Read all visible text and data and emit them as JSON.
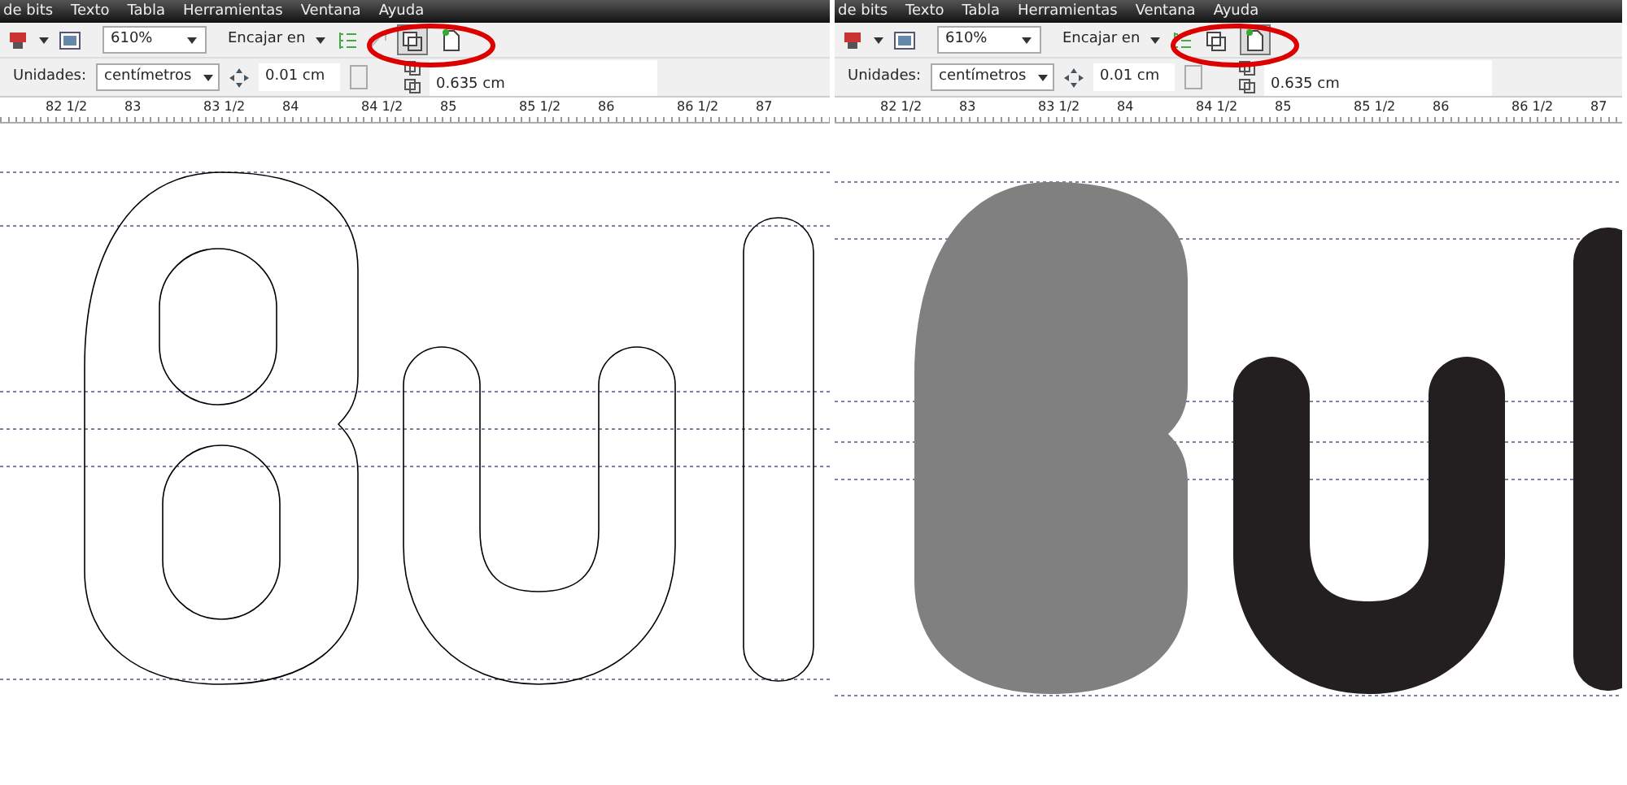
{
  "panels": [
    {
      "menu": [
        "de bits",
        "Texto",
        "Tabla",
        "Herramientas",
        "Ventana",
        "Ayuda"
      ],
      "zoom": "610%",
      "snap_label": "Encajar en",
      "view_buttons": [
        {
          "selected": true
        },
        {
          "selected": false
        }
      ],
      "units_label": "Unidades:",
      "units": "centímetros",
      "nudge": "0.01 cm",
      "offset_y": "0.635 cm",
      "ruler": [
        "82 1/2",
        "83",
        "83 1/2",
        "84",
        "84 1/2",
        "85",
        "85 1/2",
        "86",
        "86 1/2",
        "87"
      ],
      "shapes": [
        {
          "kind": "b"
        },
        {
          "kind": "u"
        },
        {
          "kind": "l"
        }
      ]
    },
    {
      "menu": [
        "de bits",
        "Texto",
        "Tabla",
        "Herramientas",
        "Ventana",
        "Ayuda"
      ],
      "zoom": "610%",
      "snap_label": "Encajar en",
      "view_buttons": [
        {
          "selected": false
        },
        {
          "selected": true
        }
      ],
      "units_label": "Unidades:",
      "units": "centímetros",
      "nudge": "0.01 cm",
      "offset_y": "0.635 cm",
      "ruler": [
        "82 1/2",
        "83",
        "83 1/2",
        "84",
        "84 1/2",
        "85",
        "85 1/2",
        "86",
        "86 1/2",
        "87"
      ],
      "shapes": [
        {
          "kind": "b",
          "color": "#808080"
        },
        {
          "kind": "u",
          "color": "#231f20"
        },
        {
          "kind": "l",
          "color": "#231f20"
        }
      ]
    }
  ]
}
